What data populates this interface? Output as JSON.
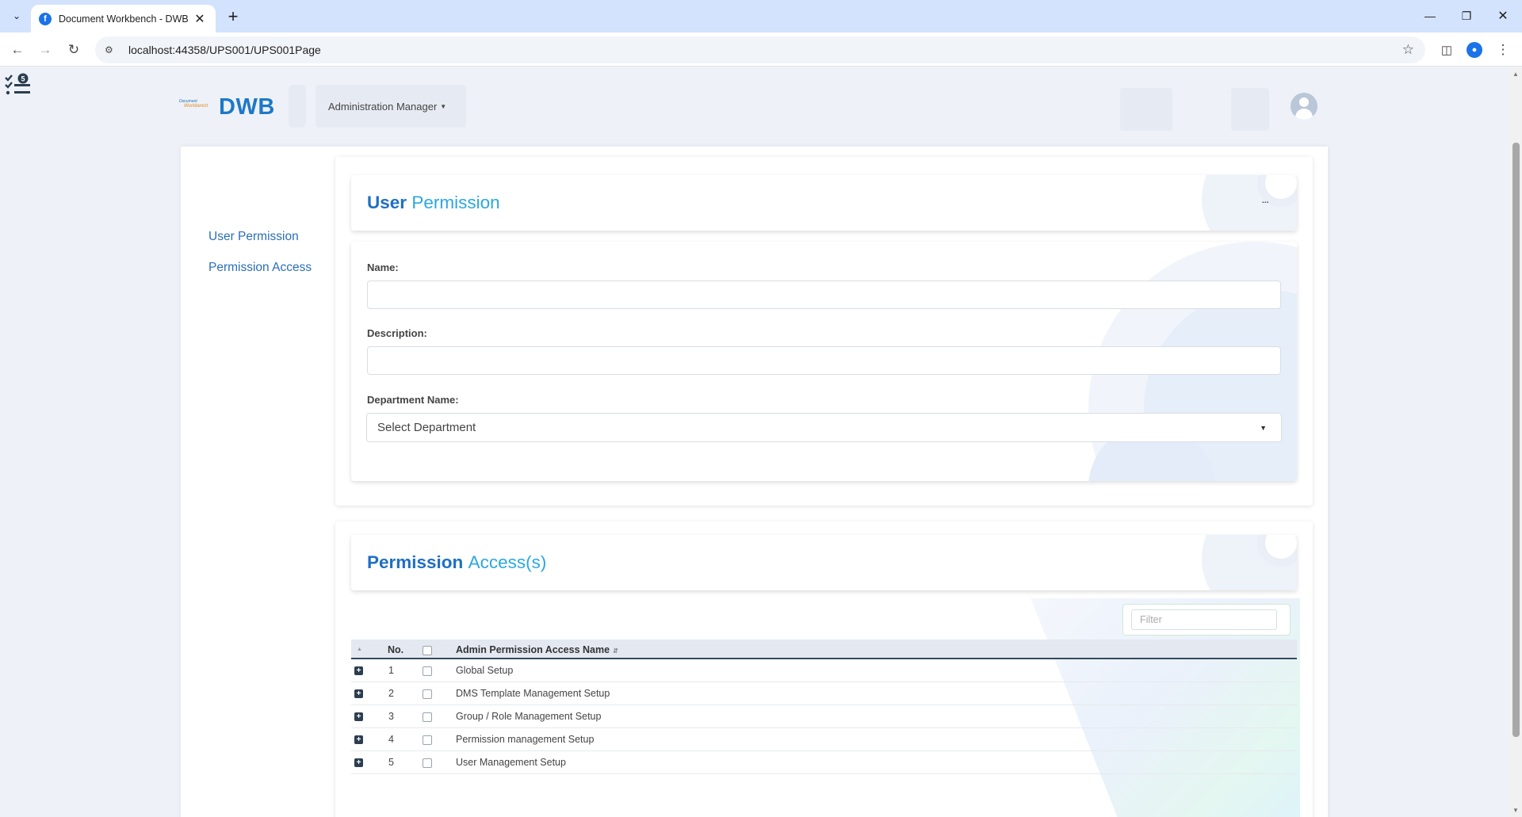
{
  "browser": {
    "tab_title": "Document Workbench - DWB",
    "url": "localhost:44358/UPS001/UPS001Page",
    "favicon_letter": "f"
  },
  "header": {
    "logo_small_top": "Document",
    "logo_small_bottom": "Workbench",
    "logo_text": "DWB",
    "role_dropdown": "Administration Manager",
    "tasks_badge": "5"
  },
  "sidebar": {
    "items": [
      {
        "label": "User Permission"
      },
      {
        "label": "Permission Access"
      }
    ]
  },
  "user_permission": {
    "title_part1": "User",
    "title_part2": "Permission",
    "menu_label": "...",
    "name_label": "Name:",
    "name_value": "",
    "description_label": "Description:",
    "description_value": "",
    "department_label": "Department Name:",
    "department_selected": "Select Department"
  },
  "permission_access": {
    "title_part1": "Permission",
    "title_part2": "Access(s)",
    "filter_placeholder": "Filter",
    "columns": {
      "no": "No.",
      "name": "Admin Permission Access Name"
    },
    "rows": [
      {
        "no": "1",
        "name": "Global Setup"
      },
      {
        "no": "2",
        "name": "DMS Template Management Setup"
      },
      {
        "no": "3",
        "name": "Group / Role Management Setup"
      },
      {
        "no": "4",
        "name": "Permission management Setup"
      },
      {
        "no": "5",
        "name": "User Management Setup"
      }
    ]
  },
  "colors": {
    "brand_blue": "#1e6fc4",
    "accent_cyan": "#2aa8e0",
    "grid_header": "#e4e9f1"
  }
}
